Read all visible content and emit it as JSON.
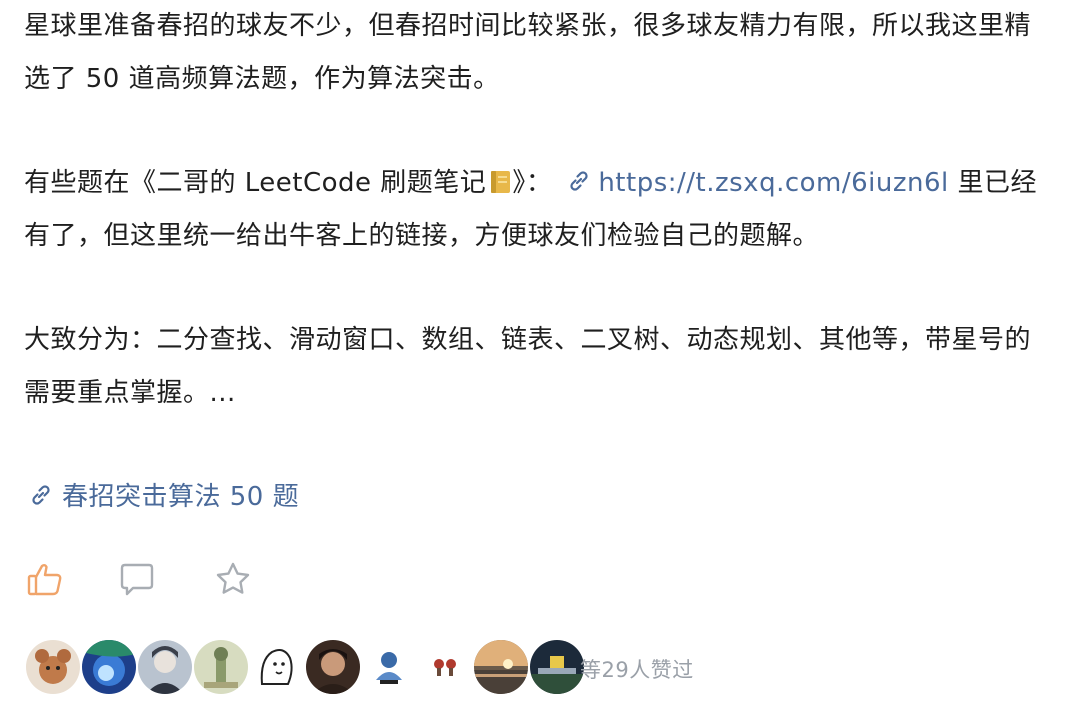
{
  "post": {
    "paragraph1": "星球里准备春招的球友不少，但春招时间比较紧张，很多球友精力有限，所以我这里精选了 50 道高频算法题，作为算法突击。",
    "paragraph2": {
      "before": "有些题在《二哥的 LeetCode 刷题笔记",
      "after_emoji": "》：",
      "link_text": "https://t.zsxq.com/6iuzn6l",
      "after_link": " 里已经有了，但这里统一给出牛客上的链接，方便球友们检验自己的题解。",
      "emoji": "notebook-emoji"
    },
    "paragraph3": "大致分为：二分查找、滑动窗口、数组、链表、二叉树、动态规划、其他等，带星号的需要重点掌握。...",
    "attachment_link": "春招突击算法 50 题"
  },
  "actions": {
    "like_icon": "thumbs-up-icon",
    "comment_icon": "comment-icon",
    "favorite_icon": "star-icon"
  },
  "likes": {
    "summary": "等29人赞过",
    "avatars": [
      "avatar-1",
      "avatar-2",
      "avatar-3",
      "avatar-4",
      "avatar-5",
      "avatar-6",
      "avatar-7",
      "avatar-8",
      "avatar-9",
      "avatar-10"
    ]
  },
  "colors": {
    "text": "#1f1f1f",
    "link": "#4a6a9a",
    "like_active": "#f0a46a",
    "icon_gray": "#a8adb3",
    "muted": "#9aa0a8"
  }
}
